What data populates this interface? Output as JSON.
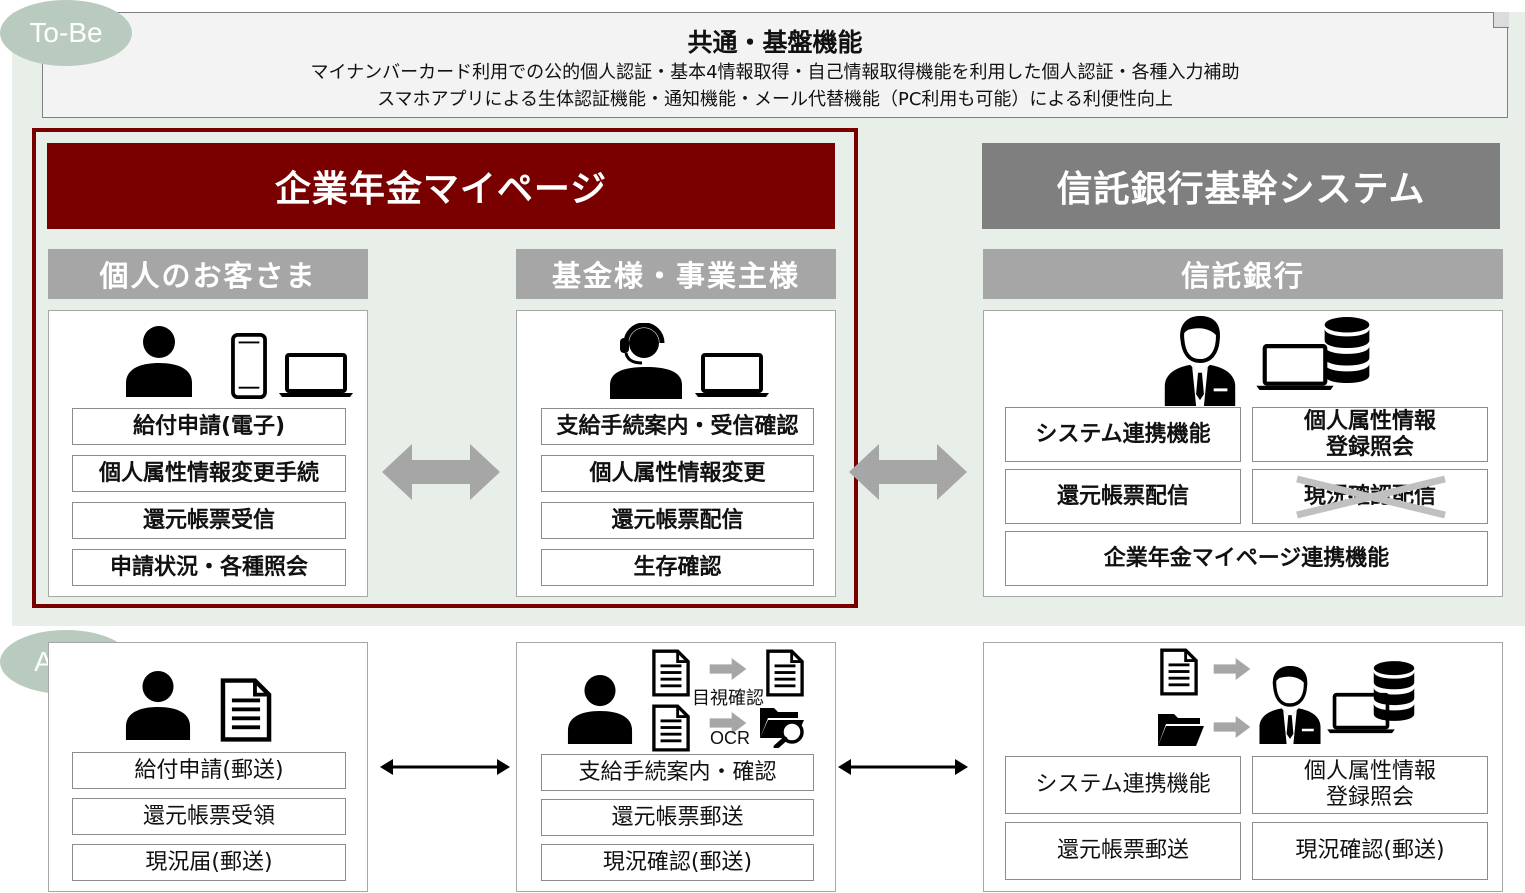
{
  "tags": {
    "tobe": "To-Be",
    "asis": "As-Is"
  },
  "common": {
    "title": "共通・基盤機能",
    "line1": "マイナンバーカード利用での公的個人認証・基本4情報取得・自己情報取得機能を利用した個人認証・各種入力補助",
    "line2": "スマホアプリによる生体認証機能・通知機能・メール代替機能（PC利用も可能）による利便性向上"
  },
  "mypage": {
    "title": "企業年金マイページ"
  },
  "trust_system": {
    "title": "信託銀行基幹システム"
  },
  "tobe": {
    "customer": {
      "title": "個人のお客さま",
      "items": [
        "給付申請(電子)",
        "個人属性情報変更手続",
        "還元帳票受信",
        "申請状況・各種照会"
      ]
    },
    "fund": {
      "title": "基金様・事業主様",
      "items": [
        "支給手続案内・受信確認",
        "個人属性情報変更",
        "還元帳票配信",
        "生存確認"
      ]
    },
    "bank": {
      "title": "信託銀行",
      "system_link": "システム連携機能",
      "attr_info": "個人属性情報\n登録照会",
      "report": "還元帳票配信",
      "crossed": "現況確認配信",
      "mypage_link": "企業年金マイページ連携機能"
    }
  },
  "asis": {
    "customer": {
      "items": [
        "給付申請(郵送)",
        "還元帳票受領",
        "現況届(郵送)"
      ]
    },
    "fund": {
      "items": [
        "支給手続案内・確認",
        "還元帳票郵送",
        "現況確認(郵送)"
      ],
      "visual_check": "目視確認",
      "ocr": "OCR"
    },
    "bank": {
      "system_link": "システム連携機能",
      "attr_info": "個人属性情報\n登録照会",
      "report": "還元帳票郵送",
      "status": "現況確認(郵送)"
    }
  },
  "colors": {
    "mypage": "#7a0000",
    "system": "#7f7f7f",
    "sub": "#a6a6a6",
    "tobe_bg": "#e8efe9",
    "tag": "#b9cbbf"
  }
}
